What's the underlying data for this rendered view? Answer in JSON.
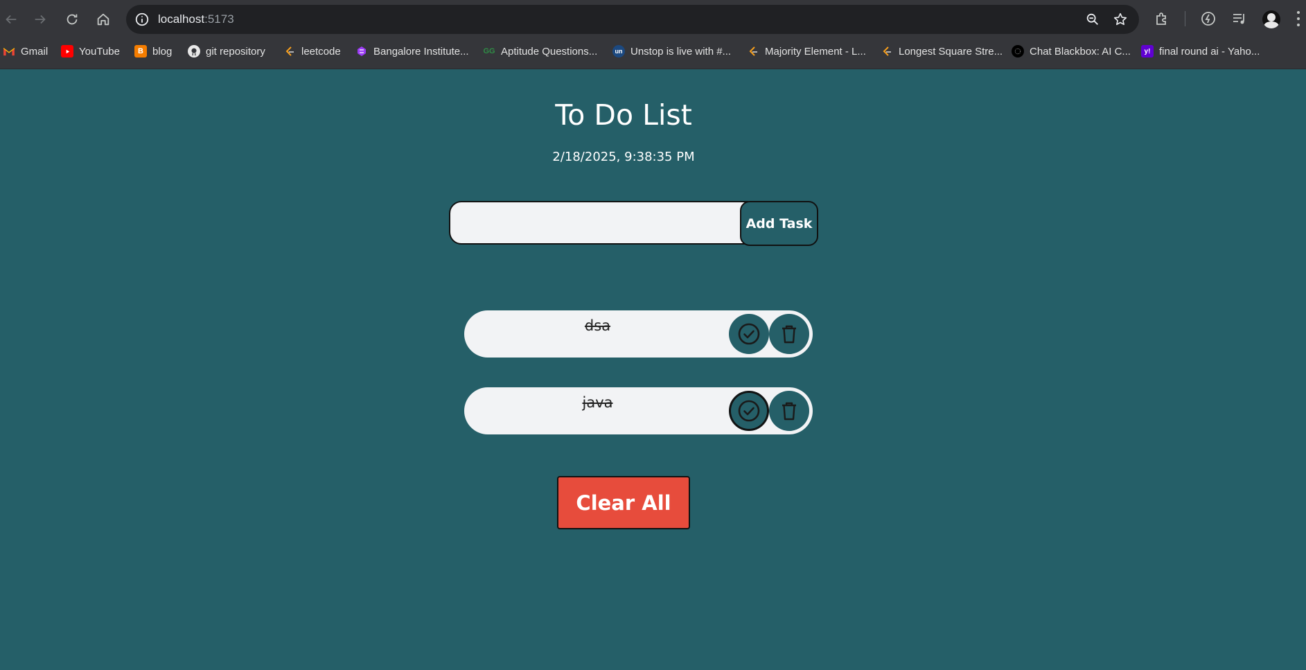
{
  "browser": {
    "url_host": "localhost",
    "url_port": ":5173",
    "bookmarks": [
      {
        "label": "Gmail",
        "icon": "gmail-icon"
      },
      {
        "label": "YouTube",
        "icon": "youtube-icon"
      },
      {
        "label": "blog",
        "icon": "blogger-icon"
      },
      {
        "label": "git repository",
        "icon": "github-icon"
      },
      {
        "label": "leetcode",
        "icon": "leetcode-icon"
      },
      {
        "label": "Bangalore Institute...",
        "icon": "bangalore-institute-icon"
      },
      {
        "label": "Aptitude Questions...",
        "icon": "geeksforgeeks-icon"
      },
      {
        "label": "Unstop is live with #...",
        "icon": "unstop-icon"
      },
      {
        "label": "Majority Element - L...",
        "icon": "leetcode-icon"
      },
      {
        "label": "Longest Square Stre...",
        "icon": "leetcode-icon"
      },
      {
        "label": "Chat Blackbox: AI C...",
        "icon": "blackbox-icon"
      },
      {
        "label": "final round ai - Yaho...",
        "icon": "yahoo-icon"
      }
    ]
  },
  "app": {
    "title": "To Do List",
    "datetime": "2/18/2025, 9:38:35 PM",
    "input": {
      "value": "",
      "placeholder": ""
    },
    "add_button": "Add Task",
    "tasks": [
      {
        "text": "dsa",
        "completed": true
      },
      {
        "text": "java",
        "completed": true
      }
    ],
    "clear_button": "Clear All"
  },
  "colors": {
    "background": "#255f68",
    "clear_button": "#e74c3c",
    "task_bg": "#f2f3f5"
  }
}
